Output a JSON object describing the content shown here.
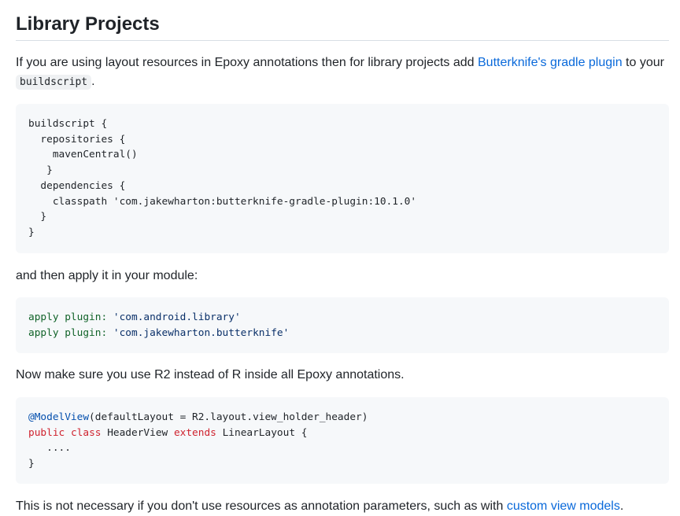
{
  "heading": "Library Projects",
  "intro": {
    "text_before": "If you are using layout resources in Epoxy annotations then for library projects add ",
    "link": "Butterknife's gradle plugin",
    "text_after": " to your ",
    "code": "buildscript",
    "end": "."
  },
  "code_block_1": {
    "lines": [
      "buildscript {",
      "  repositories {",
      "    mavenCentral()",
      "   }",
      "  dependencies {",
      "    classpath 'com.jakewharton:butterknife-gradle-plugin:10.1.0'",
      "  }",
      "}"
    ]
  },
  "apply_text": "and then apply it in your module:",
  "code_block_2": {
    "line1_label": "apply plugin:",
    "line1_value": " 'com.android.library'",
    "line2_label": "apply plugin:",
    "line2_value": " 'com.jakewharton.butterknife'"
  },
  "r2_text": "Now make sure you use R2 instead of R inside all Epoxy annotations.",
  "code_block_3": {
    "annotation": "@ModelView",
    "annotation_rest": "(defaultLayout = R2.layout.view_holder_header)",
    "kw_public": "public",
    "kw_class": "class",
    "class_name": " HeaderView ",
    "kw_extends": "extends",
    "class_rest": " LinearLayout {",
    "body": "   ....",
    "close": "}"
  },
  "footer": {
    "text_before": "This is not necessary if you don't use resources as annotation parameters, such as with ",
    "link": "custom view models",
    "end": "."
  }
}
